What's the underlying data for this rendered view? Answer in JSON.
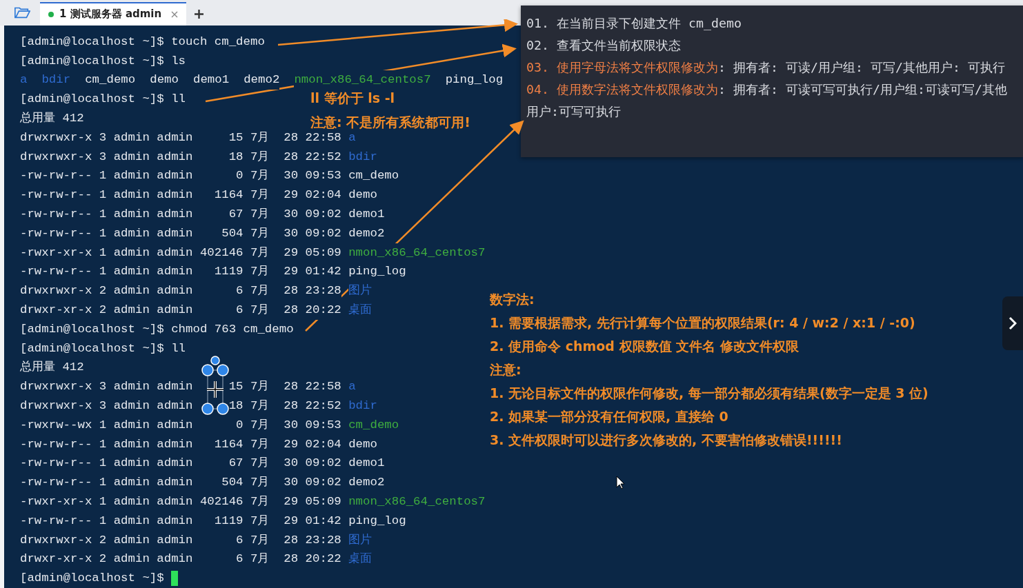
{
  "tab_bar": {
    "tabs": [
      {
        "label": "1 测试服务器 admin",
        "selected": true,
        "connected": true
      }
    ]
  },
  "terminal": {
    "lines": [
      {
        "kind": "text",
        "text": "[admin@localhost ~]$ touch cm_demo"
      },
      {
        "kind": "text",
        "text": "[admin@localhost ~]$ ls"
      },
      {
        "kind": "names",
        "items": [
          {
            "text": "a",
            "color": "#2f6bd0"
          },
          {
            "text": "bdir",
            "color": "#2f6bd0"
          },
          {
            "text": "cm_demo",
            "color": "#e6e9ee"
          },
          {
            "text": "demo",
            "color": "#e6e9ee"
          },
          {
            "text": "demo1",
            "color": "#e6e9ee"
          },
          {
            "text": "demo2",
            "color": "#e6e9ee"
          },
          {
            "text": "nmon_x86_64_centos7",
            "color": "#3fae3f"
          },
          {
            "text": "ping_log",
            "color": "#e6e9ee"
          }
        ]
      },
      {
        "kind": "text",
        "text": "[admin@localhost ~]$ ll"
      },
      {
        "kind": "text",
        "text": "总用量 412"
      },
      {
        "kind": "entry",
        "meta": "drwxrwxr-x 3 admin admin     15 7月  28 22:58",
        "name": "a",
        "color": "#2f6bd0"
      },
      {
        "kind": "entry",
        "meta": "drwxrwxr-x 3 admin admin     18 7月  28 22:52",
        "name": "bdir",
        "color": "#2f6bd0"
      },
      {
        "kind": "entry",
        "meta": "-rw-rw-r-- 1 admin admin      0 7月  30 09:53",
        "name": "cm_demo",
        "color": "#e6e9ee"
      },
      {
        "kind": "entry",
        "meta": "-rw-rw-r-- 1 admin admin   1164 7月  29 02:04",
        "name": "demo",
        "color": "#e6e9ee"
      },
      {
        "kind": "entry",
        "meta": "-rw-rw-r-- 1 admin admin     67 7月  30 09:02",
        "name": "demo1",
        "color": "#e6e9ee"
      },
      {
        "kind": "entry",
        "meta": "-rw-rw-r-- 1 admin admin    504 7月  30 09:02",
        "name": "demo2",
        "color": "#e6e9ee"
      },
      {
        "kind": "entry",
        "meta": "-rwxr-xr-x 1 admin admin 402146 7月  29 05:09",
        "name": "nmon_x86_64_centos7",
        "color": "#3fae3f"
      },
      {
        "kind": "entry",
        "meta": "-rw-rw-r-- 1 admin admin   1119 7月  29 01:42",
        "name": "ping_log",
        "color": "#e6e9ee"
      },
      {
        "kind": "entry",
        "meta": "drwxrwxr-x 2 admin admin      6 7月  28 23:28",
        "name": "图片",
        "color": "#2f6bd0"
      },
      {
        "kind": "entry",
        "meta": "drwxr-xr-x 2 admin admin      6 7月  28 20:22",
        "name": "桌面",
        "color": "#2f6bd0"
      },
      {
        "kind": "text",
        "text": "[admin@localhost ~]$ chmod 763 cm_demo"
      },
      {
        "kind": "text",
        "text": "[admin@localhost ~]$ ll"
      },
      {
        "kind": "text",
        "text": "总用量 412"
      },
      {
        "kind": "entry",
        "meta": "drwxrwxr-x 3 admin admin     15 7月  28 22:58",
        "name": "a",
        "color": "#2f6bd0"
      },
      {
        "kind": "entry",
        "meta": "drwxrwxr-x 3 admin admin     18 7月  28 22:52",
        "name": "bdir",
        "color": "#2f6bd0"
      },
      {
        "kind": "entry",
        "meta": "-rwxrw--wx 1 admin admin      0 7月  30 09:53",
        "name": "cm_demo",
        "color": "#3fae3f"
      },
      {
        "kind": "entry",
        "meta": "-rw-rw-r-- 1 admin admin   1164 7月  29 02:04",
        "name": "demo",
        "color": "#e6e9ee"
      },
      {
        "kind": "entry",
        "meta": "-rw-rw-r-- 1 admin admin     67 7月  30 09:02",
        "name": "demo1",
        "color": "#e6e9ee"
      },
      {
        "kind": "entry",
        "meta": "-rw-rw-r-- 1 admin admin    504 7月  30 09:02",
        "name": "demo2",
        "color": "#e6e9ee"
      },
      {
        "kind": "entry",
        "meta": "-rwxr-xr-x 1 admin admin 402146 7月  29 05:09",
        "name": "nmon_x86_64_centos7",
        "color": "#3fae3f"
      },
      {
        "kind": "entry",
        "meta": "-rw-rw-r-- 1 admin admin   1119 7月  29 01:42",
        "name": "ping_log",
        "color": "#e6e9ee"
      },
      {
        "kind": "entry",
        "meta": "drwxrwxr-x 2 admin admin      6 7月  28 23:28",
        "name": "图片",
        "color": "#2f6bd0"
      },
      {
        "kind": "entry",
        "meta": "drwxr-xr-x 2 admin admin      6 7月  28 20:22",
        "name": "桌面",
        "color": "#2f6bd0"
      },
      {
        "kind": "prompt",
        "text": "[admin@localhost ~]$"
      }
    ]
  },
  "ll_note": [
    "ll 等价于 ls -l",
    "注意: 不是所有系统都可用!"
  ],
  "task_panel": {
    "items": [
      {
        "number": "01.",
        "rest": "在当前目录下创建文件 cm_demo"
      },
      {
        "number": "02.",
        "rest": "查看文件当前权限状态"
      },
      {
        "number": "03.",
        "lead": "使用字母法将文件权限修改为",
        "rest": ": 拥有者: 可读/用户组: 可写/其他用户: 可执行"
      },
      {
        "number": "04.",
        "lead": "使用数字法将文件权限修改为",
        "rest": ": 拥有者: 可读可写可执行/用户组:可读可写/其他用户:可写可执行"
      }
    ]
  },
  "notes": [
    "数字法:",
    "1. 需要根据需求, 先行计算每个位置的权限结果(r: 4 / w:2 / x:1 / -:0)",
    "2. 使用命令 chmod 权限数值 文件名 修改文件权限",
    "注意:",
    "1. 无论目标文件的权限作何修改, 每一部分都必须有结果(数字一定是 3 位)",
    "2. 如果某一部分没有任何权限, 直接给 0",
    "3. 文件权限时可以进行多次修改的, 不要害怕修改错误!!!!!!"
  ]
}
